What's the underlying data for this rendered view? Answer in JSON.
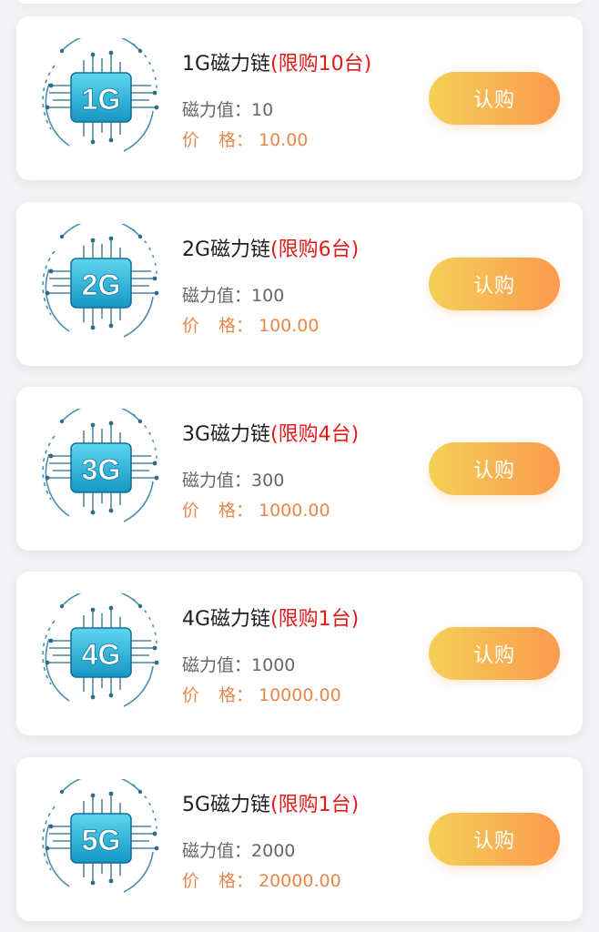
{
  "products": [
    {
      "chip_label": "1G",
      "name": "1G磁力链",
      "limit": "(限购10台)",
      "value_label": "磁力值：",
      "value": "10",
      "price_label_1": "价",
      "price_label_2": "格：",
      "price": "10.00",
      "buy_label": "认购"
    },
    {
      "chip_label": "2G",
      "name": "2G磁力链",
      "limit": "(限购6台)",
      "value_label": "磁力值：",
      "value": "100",
      "price_label_1": "价",
      "price_label_2": "格：",
      "price": "100.00",
      "buy_label": "认购"
    },
    {
      "chip_label": "3G",
      "name": "3G磁力链",
      "limit": "(限购4台)",
      "value_label": "磁力值：",
      "value": "300",
      "price_label_1": "价",
      "price_label_2": "格：",
      "price": "1000.00",
      "buy_label": "认购"
    },
    {
      "chip_label": "4G",
      "name": "4G磁力链",
      "limit": "(限购1台)",
      "value_label": "磁力值：",
      "value": "1000",
      "price_label_1": "价",
      "price_label_2": "格：",
      "price": "10000.00",
      "buy_label": "认购"
    },
    {
      "chip_label": "5G",
      "name": "5G磁力链",
      "limit": "(限购1台)",
      "value_label": "磁力值：",
      "value": "2000",
      "price_label_1": "价",
      "price_label_2": "格：",
      "price": "20000.00",
      "buy_label": "认购"
    }
  ],
  "colors": {
    "limit_red": "#e21b1b",
    "price_orange": "#e8874a",
    "button_gradient_start": "#f4d057",
    "button_gradient_end": "#fb9a4e",
    "chip_teal": "#1fb3d6"
  },
  "icons": {
    "product_thumbnail": "circuit-chip-icon"
  }
}
